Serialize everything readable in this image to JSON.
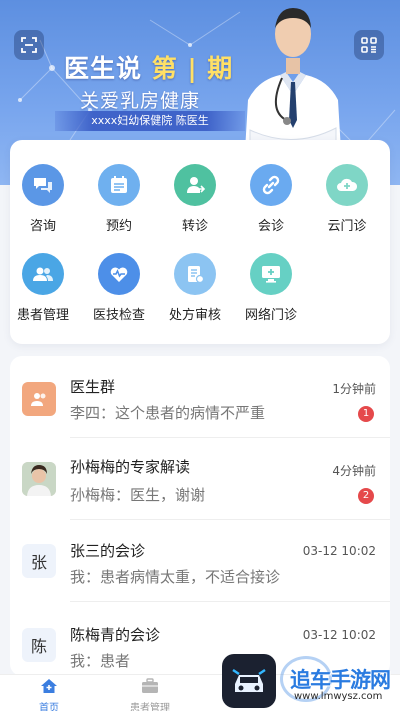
{
  "banner": {
    "title_main": "医生说",
    "title_accent": "第 | 期",
    "subtitle": "关爱乳房健康",
    "tag": "xxxx妇幼保健院  陈医生",
    "left_icon": "scan-icon",
    "right_icon": "grid-menu-icon"
  },
  "features": [
    {
      "label": "咨询",
      "icon": "chat-bubbles-icon",
      "color": "#5b97e6"
    },
    {
      "label": "预约",
      "icon": "calendar-icon",
      "color": "#6fb0ef"
    },
    {
      "label": "转诊",
      "icon": "user-transfer-icon",
      "color": "#4fc1a0"
    },
    {
      "label": "会诊",
      "icon": "link-icon",
      "color": "#6aaaf0"
    },
    {
      "label": "云门诊",
      "icon": "cloud-plus-icon",
      "color": "#7fd6c6"
    },
    {
      "label": "患者管理",
      "icon": "users-icon",
      "color": "#4aa6e5"
    },
    {
      "label": "医技检查",
      "icon": "heart-pulse-icon",
      "color": "#4d8fe8"
    },
    {
      "label": "处方审核",
      "icon": "prescription-icon",
      "color": "#8cc4f2"
    },
    {
      "label": "网络门诊",
      "icon": "monitor-plus-icon",
      "color": "#66d0c4"
    }
  ],
  "messages": [
    {
      "name": "医生群",
      "text": "李四：这个患者的病情不严重",
      "time": "1分钟前",
      "badge": "1",
      "avatar": "group-icon"
    },
    {
      "name": "孙梅梅的专家解读",
      "text": "孙梅梅：医生，谢谢",
      "time": "4分钟前",
      "badge": "2",
      "avatar": "photo"
    },
    {
      "name": "张三的会诊",
      "text": "我：患者病情太重，不适合接诊",
      "time": "03-12 10:02",
      "badge": "",
      "avatar_text": "张"
    },
    {
      "name": "陈梅青的会诊",
      "text": "我：患者",
      "time": "03-12 10:02",
      "badge": "",
      "avatar_text": "陈"
    }
  ],
  "tabs": [
    {
      "label": "首页",
      "icon": "home-icon",
      "active": true
    },
    {
      "label": "患者管理",
      "icon": "briefcase-icon",
      "active": false
    }
  ],
  "watermark": {
    "text": "追车手游网",
    "url": "www.lmwysz.com"
  },
  "colors": {
    "accent": "#3b7ee0",
    "badge": "#e5494b",
    "banner": "#6b9ae8"
  }
}
